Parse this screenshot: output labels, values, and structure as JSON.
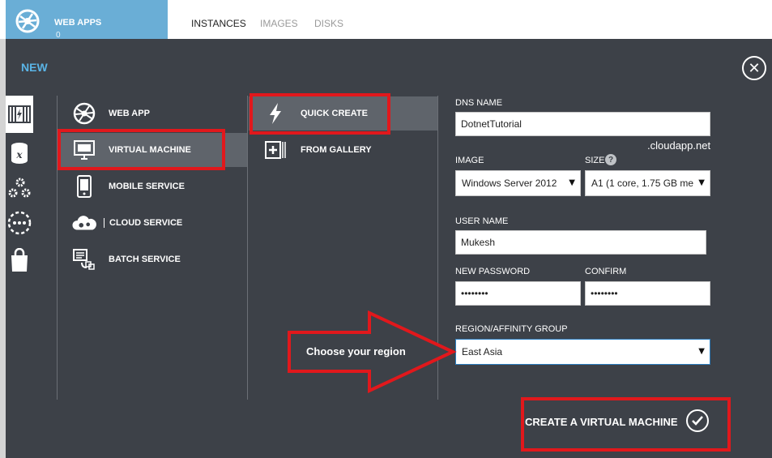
{
  "header": {
    "app_name": "WEB APPS",
    "app_count": "0",
    "tabs": [
      {
        "label": "INSTANCES",
        "active": true
      },
      {
        "label": "IMAGES",
        "active": false
      },
      {
        "label": "DISKS",
        "active": false
      }
    ]
  },
  "panel": {
    "title": "NEW",
    "close_icon": "close-icon"
  },
  "rail": [
    {
      "icon": "compute-icon",
      "selected": true
    },
    {
      "icon": "data-services-icon",
      "selected": false
    },
    {
      "icon": "app-services-icon",
      "selected": false
    },
    {
      "icon": "network-services-icon",
      "selected": false
    },
    {
      "icon": "store-icon",
      "selected": false
    }
  ],
  "categories": [
    {
      "label": "WEB APP",
      "icon": "globe-icon",
      "selected": false
    },
    {
      "label": "VIRTUAL MACHINE",
      "icon": "monitor-icon",
      "selected": true
    },
    {
      "label": "MOBILE SERVICE",
      "icon": "mobile-icon",
      "selected": false
    },
    {
      "label": "CLOUD SERVICE",
      "icon": "cloud-gear-icon",
      "selected": false
    },
    {
      "label": "BATCH SERVICE",
      "icon": "batch-icon",
      "selected": false
    }
  ],
  "options": [
    {
      "label": "QUICK CREATE",
      "icon": "lightning-icon",
      "selected": true
    },
    {
      "label": "FROM GALLERY",
      "icon": "gallery-plus-icon",
      "selected": false
    }
  ],
  "form": {
    "dns_label": "DNS NAME",
    "dns_value": "DotnetTutorial",
    "dns_suffix": ".cloudapp.net",
    "image_label": "IMAGE",
    "image_value": "Windows Server 2012",
    "size_label": "SIZE",
    "size_help": "?",
    "size_value": "A1 (1 core, 1.75 GB me",
    "username_label": "USER NAME",
    "username_value": "Mukesh",
    "password_label": "NEW PASSWORD",
    "password_value": "••••••••",
    "confirm_label": "CONFIRM",
    "confirm_value": "••••••••",
    "region_label": "REGION/AFFINITY GROUP",
    "region_value": "East Asia"
  },
  "annotation": {
    "arrow_text": "Choose your region",
    "highlight_color": "#e1181c"
  },
  "actions": {
    "create_label": "CREATE A VIRTUAL MACHINE",
    "check_icon": "checkmark-icon"
  },
  "colors": {
    "panel_bg": "#3d4148",
    "accent_blue": "#5ab4e6",
    "tile_blue": "#6aaed6",
    "selected_bg": "#5f646b"
  }
}
